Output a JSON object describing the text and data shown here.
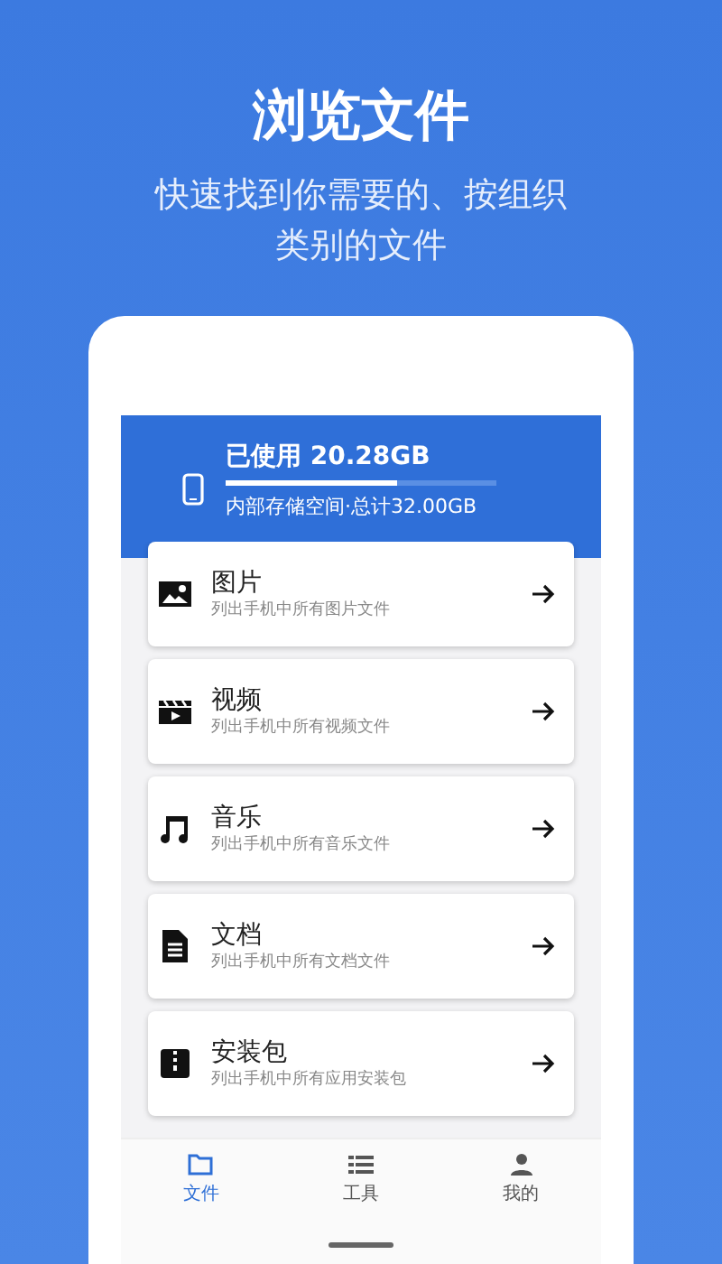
{
  "headline": "浏览文件",
  "subtitle": "快速找到你需要的、按组织类别的文件",
  "storage": {
    "used": "已使用 20.28GB",
    "level": 0.63,
    "detail": "内部存储空间·总计32.00GB"
  },
  "categories": [
    {
      "kind": "picture",
      "title": "图片",
      "description": "列出手机中所有图片文件"
    },
    {
      "kind": "video",
      "title": "视频",
      "description": "列出手机中所有视频文件"
    },
    {
      "kind": "music",
      "title": "音乐",
      "description": "列出手机中所有音乐文件"
    },
    {
      "kind": "document",
      "title": "文档",
      "description": "列出手机中所有文档文件"
    },
    {
      "kind": "package",
      "title": "安装包",
      "description": "列出手机中所有应用安装包"
    }
  ],
  "nav": [
    {
      "kind": "files",
      "label": "文件",
      "selected": true
    },
    {
      "kind": "tools",
      "label": "工具",
      "selected": false
    },
    {
      "kind": "me",
      "label": "我的",
      "selected": false
    }
  ]
}
